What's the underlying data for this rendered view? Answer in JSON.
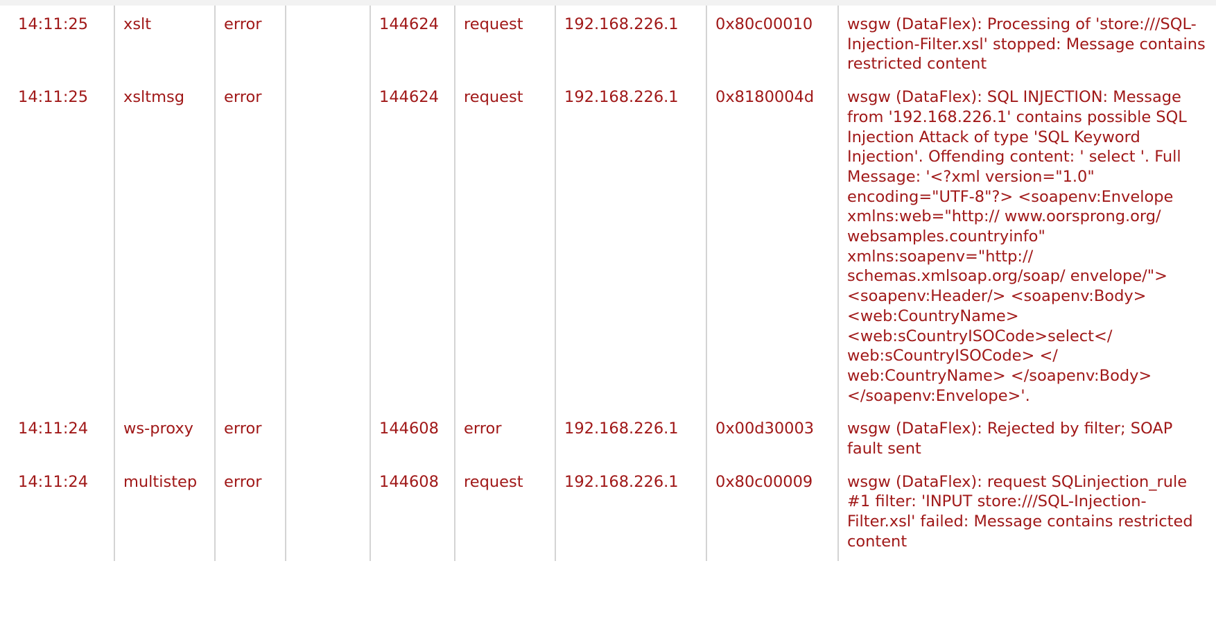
{
  "log": {
    "rows": [
      {
        "time": "14:11:25",
        "category": "xslt",
        "level": "error",
        "domain": "",
        "tid": "144624",
        "direction": "request",
        "client": "192.168.226.1",
        "msgid": "0x80c00010",
        "message": "wsgw (DataFlex): Processing of 'store:///SQL-Injection-Filter.xsl' stopped: Message contains restricted content"
      },
      {
        "time": "14:11:25",
        "category": "xsltmsg",
        "level": "error",
        "domain": "",
        "tid": "144624",
        "direction": "request",
        "client": "192.168.226.1",
        "msgid": "0x8180004d",
        "message": "wsgw (DataFlex): SQL INJECTION: Message from '192.168.226.1' contains possible SQL Injection Attack of type 'SQL Keyword Injection'. Offending content: ' select '. Full Message: '<?xml version=\"1.0\" encoding=\"UTF-8\"?> <soapenv:Envelope xmlns:web=\"http:// www.oorsprong.org/ websamples.countryinfo\" xmlns:soapenv=\"http:// schemas.xmlsoap.org/soap/ envelope/\"> <soapenv:Header/> <soapenv:Body> <web:CountryName> <web:sCountryISOCode>select</ web:sCountryISOCode> </ web:CountryName> </soapenv:Body> </soapenv:Envelope>'."
      },
      {
        "time": "14:11:24",
        "category": "ws-proxy",
        "level": "error",
        "domain": "",
        "tid": "144608",
        "direction": "error",
        "client": "192.168.226.1",
        "msgid": "0x00d30003",
        "message": "wsgw (DataFlex): Rejected by filter; SOAP fault sent"
      },
      {
        "time": "14:11:24",
        "category": "multistep",
        "level": "error",
        "domain": "",
        "tid": "144608",
        "direction": "request",
        "client": "192.168.226.1",
        "msgid": "0x80c00009",
        "message": "wsgw (DataFlex): request SQLinjection_rule #1 filter: 'INPUT store:///SQL-Injection-Filter.xsl' failed: Message contains restricted content"
      }
    ]
  },
  "colors": {
    "text": "#a01818",
    "divider": "#d4d4d4",
    "background": "#ffffff"
  }
}
